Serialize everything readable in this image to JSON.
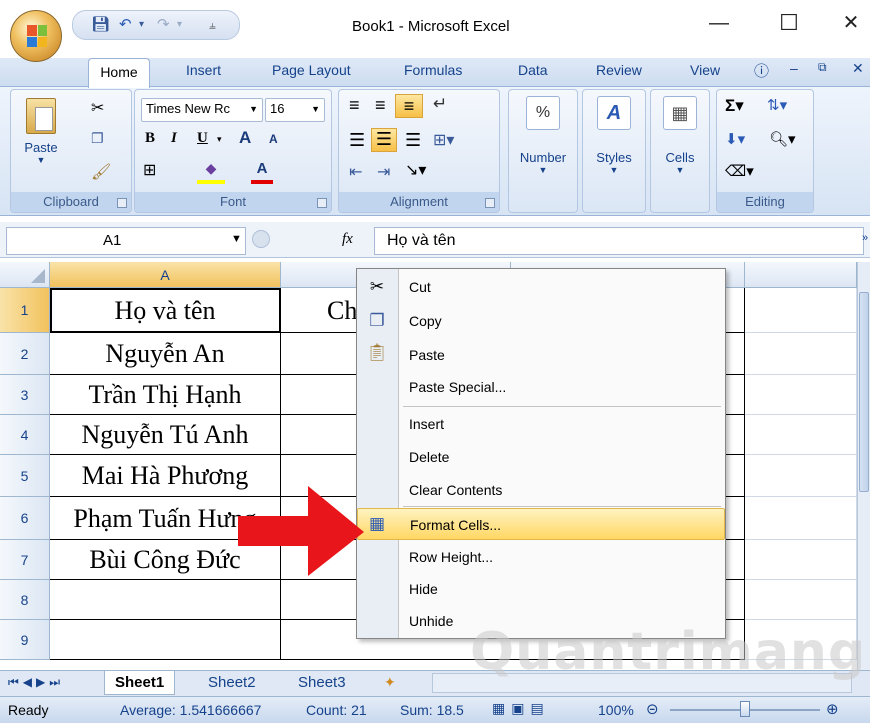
{
  "window": {
    "title": "Book1 - Microsoft Excel"
  },
  "tabs": [
    "Home",
    "Insert",
    "Page Layout",
    "Formulas",
    "Data",
    "Review",
    "View"
  ],
  "ribbon": {
    "clipboard": {
      "label": "Clipboard",
      "paste": "Paste"
    },
    "font": {
      "label": "Font",
      "name": "Times New Rc",
      "size": "16",
      "bold": "B",
      "italic": "I",
      "underline": "U",
      "grow": "A",
      "shrink": "A"
    },
    "alignment": {
      "label": "Alignment"
    },
    "number": {
      "label": "Number",
      "pct": "%"
    },
    "styles": {
      "label": "Styles"
    },
    "cells": {
      "label": "Cells"
    },
    "editing": {
      "label": "Editing"
    }
  },
  "formula_bar": {
    "name_box": "A1",
    "fx": "fx",
    "content": "Họ và tên"
  },
  "grid": {
    "columns": [
      "A"
    ],
    "rows": [
      "1",
      "2",
      "3",
      "4",
      "5",
      "6",
      "7",
      "8",
      "9"
    ],
    "colA": [
      "Họ và tên",
      "Nguyễn An",
      "Trần Thị Hạnh",
      "Nguyễn Tú Anh",
      "Mai Hà Phương",
      "Phạm Tuấn Hưng",
      "Bùi Công Đức",
      "",
      ""
    ],
    "colB_partial": "Ch"
  },
  "context_menu": {
    "items": [
      {
        "label": "Cut",
        "icon": "scissors-icon"
      },
      {
        "label": "Copy",
        "icon": "copy-icon"
      },
      {
        "label": "Paste",
        "icon": "paste-icon"
      },
      {
        "label": "Paste Special...",
        "icon": ""
      },
      {
        "label": "Insert",
        "icon": ""
      },
      {
        "label": "Delete",
        "icon": ""
      },
      {
        "label": "Clear Contents",
        "icon": ""
      },
      {
        "label": "Format Cells...",
        "icon": "format-cells-icon",
        "highlighted": true
      },
      {
        "label": "Row Height...",
        "icon": ""
      },
      {
        "label": "Hide",
        "icon": ""
      },
      {
        "label": "Unhide",
        "icon": ""
      }
    ]
  },
  "sheets": [
    "Sheet1",
    "Sheet2",
    "Sheet3"
  ],
  "status": {
    "ready": "Ready",
    "average": "Average: 1.541666667",
    "count": "Count: 21",
    "sum": "Sum: 18.5",
    "zoom": "100%"
  },
  "watermark": "Quantrimang",
  "colors": {
    "accent": "#15428b",
    "arrow": "#e8161b",
    "highlight": "#ffd764"
  }
}
